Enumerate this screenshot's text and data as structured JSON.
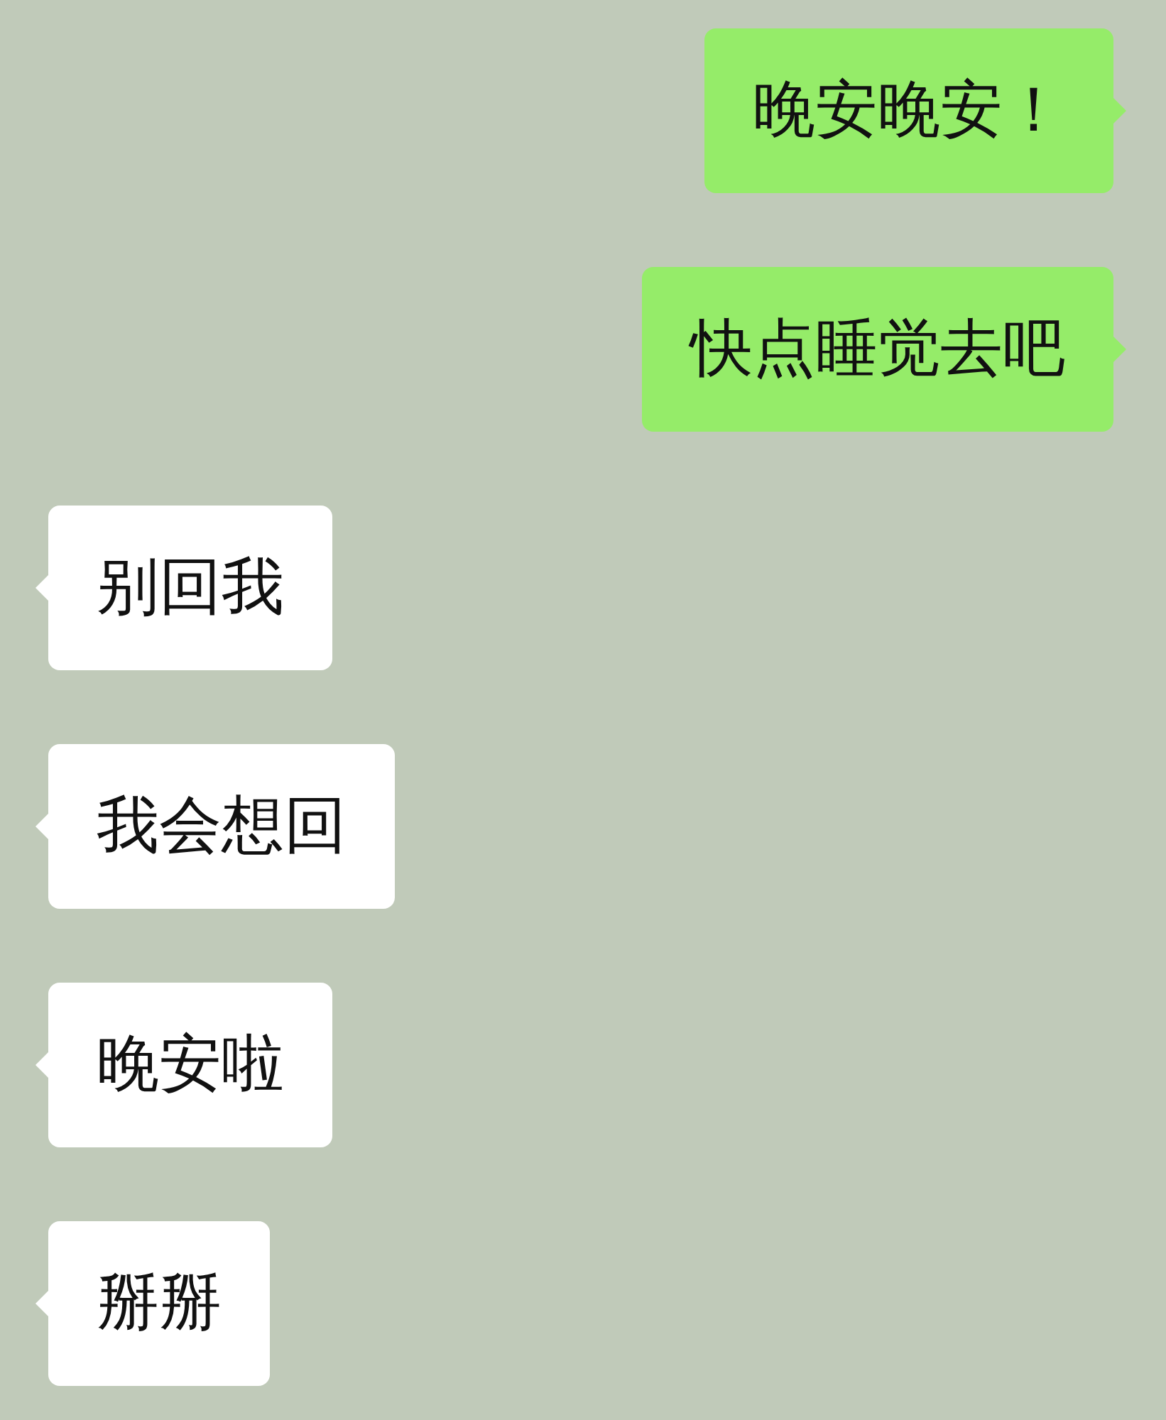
{
  "messages": [
    {
      "kind": "outgoing",
      "text": "晚安晚安！"
    },
    {
      "kind": "outgoing",
      "text": "快点睡觉去吧"
    },
    {
      "kind": "incoming",
      "text": "别回我"
    },
    {
      "kind": "incoming",
      "text": "我会想回"
    },
    {
      "kind": "incoming",
      "text": "晚安啦"
    },
    {
      "kind": "incoming",
      "text": "掰掰"
    }
  ]
}
